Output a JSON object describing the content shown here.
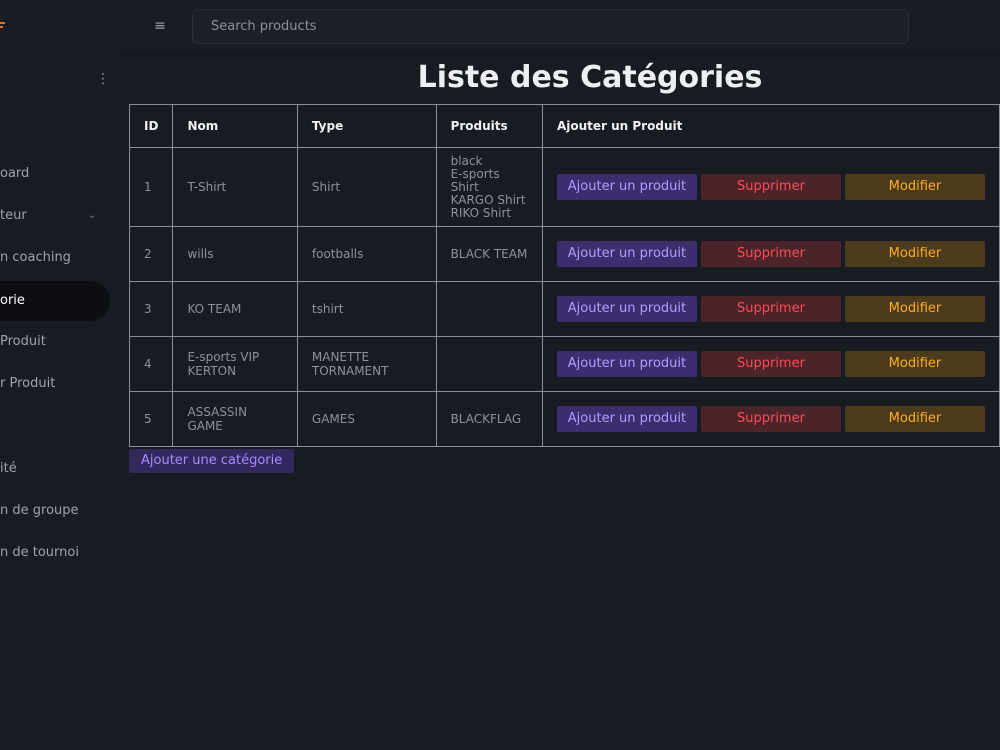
{
  "search": {
    "placeholder": "Search products"
  },
  "sidebar": {
    "items": [
      {
        "label": "oard"
      },
      {
        "label": "teur"
      },
      {
        "label": "n coaching"
      },
      {
        "label": "orie"
      },
      {
        "label": "Produit"
      },
      {
        "label": "r Produit"
      },
      {
        "label": "ité"
      },
      {
        "label": "n de groupe"
      },
      {
        "label": "n de tournoi"
      }
    ]
  },
  "page": {
    "title": "Liste des Catégories"
  },
  "table": {
    "headers": [
      "ID",
      "Nom",
      "Type",
      "Produits",
      "Ajouter un Produit"
    ],
    "rows": [
      {
        "id": "1",
        "nom": "T-Shirt",
        "type": "Shirt",
        "produits": [
          "black",
          "E-sports Shirt",
          "KARGO Shirt",
          "RIKO Shirt"
        ]
      },
      {
        "id": "2",
        "nom": "wills",
        "type": "footballs",
        "produits": [
          "BLACK TEAM"
        ]
      },
      {
        "id": "3",
        "nom": "KO TEAM",
        "type": "tshirt",
        "produits": []
      },
      {
        "id": "4",
        "nom": "E-sports VIP KERTON",
        "type": "MANETTE TORNAMENT",
        "produits": []
      },
      {
        "id": "5",
        "nom": "ASSASSIN GAME",
        "type": "GAMES",
        "produits": [
          "BLACKFLAG"
        ]
      }
    ]
  },
  "actions": {
    "add_product_label": "Ajouter un produit",
    "delete_label": "Supprimer",
    "edit_label": "Modifier"
  },
  "add_category_label": "Ajouter une catégorie",
  "colors": {
    "background": "#191b23",
    "accent_purple": "#b49cff",
    "danger_red": "#ff4b55",
    "warning_orange": "#ffac26"
  }
}
